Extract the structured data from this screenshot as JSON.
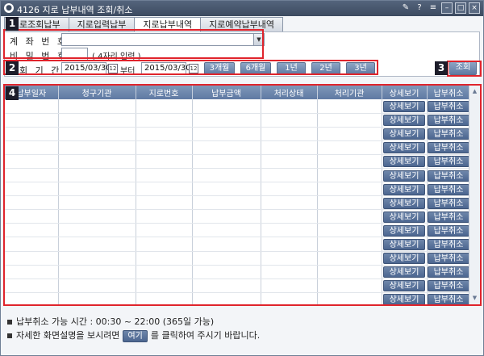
{
  "window": {
    "title": "4126 지로 납부내역 조회/취소",
    "logo_glyph": "●"
  },
  "title_controls": [
    {
      "name": "pin-icon",
      "glyph": "✎"
    },
    {
      "name": "help-icon",
      "glyph": "?"
    },
    {
      "name": "menu-icon",
      "glyph": "≡"
    },
    {
      "name": "minimize-icon",
      "glyph": "–"
    },
    {
      "name": "maximize-icon",
      "glyph": "□"
    },
    {
      "name": "close-icon",
      "glyph": "×"
    }
  ],
  "tabs": [
    {
      "label": "로조회납부",
      "active": false
    },
    {
      "label": "지로입력납부",
      "active": false
    },
    {
      "label": "지로납부내역",
      "active": true
    },
    {
      "label": "지로예약납부내역",
      "active": false
    }
  ],
  "badges": [
    "1",
    "2",
    "3",
    "4"
  ],
  "form": {
    "account_label": "계 좌 번 호",
    "account_value": "",
    "password_label": "비 밀 번 호",
    "password_value": "",
    "password_hint": "( 4자리 입력 )",
    "period_label": "회 기 간",
    "date_from": "2015/03/30",
    "date_between": "부터",
    "date_to": "2015/03/30",
    "period_buttons": [
      "3개월",
      "6개월",
      "1년",
      "2년",
      "3년"
    ],
    "search_button": "조회",
    "dropdown_glyph": "▼",
    "calendar_glyph": "12"
  },
  "grid": {
    "columns": [
      "납부일자",
      "청구기관",
      "지로번호",
      "납부금액",
      "처리상태",
      "처리기관",
      "상세보기",
      "납부취소"
    ],
    "detail_button": "상세보기",
    "cancel_button": "납부취소",
    "row_count": 15,
    "scroll_up_glyph": "▲",
    "scroll_down_glyph": "▼"
  },
  "notes": {
    "line1": "납부취소 가능 시간 : 00:30 ~ 22:00 (365일 가능)",
    "line2_before": "자세한 화면설명을 보시려면",
    "line2_button": "여기",
    "line2_after": "를 클릭하여 주시기 바랍니다."
  },
  "colors": {
    "accent_red": "#e0242c",
    "header_blue": "#5f7aa3"
  }
}
